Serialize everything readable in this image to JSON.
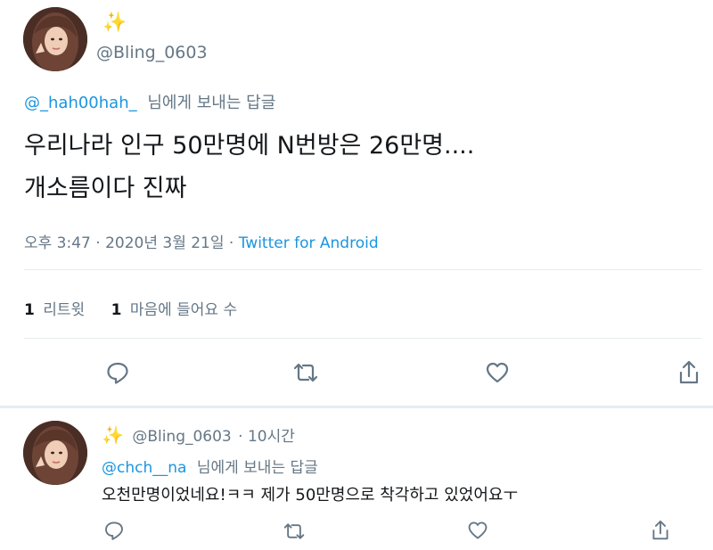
{
  "main_tweet": {
    "sparkle": "✨",
    "handle": "@Bling_0603",
    "reply_to_user": "@_hah00hah_",
    "reply_to_suffix": "님에게 보내는 답글",
    "text_line1": "우리나라 인구 50만명에 N번방은 26만명....",
    "text_line2": "개소름이다 진짜",
    "timestamp": "오후 3:47 · 2020년 3월 21일 · ",
    "source": "Twitter for Android",
    "retweet_count": "1",
    "retweet_label": "리트윗",
    "like_count": "1",
    "like_label": "마음에 들어요 수"
  },
  "reply_tweet": {
    "sparkle": "✨",
    "handle": "@Bling_0603",
    "time": "· 10시간",
    "reply_to_user": "@chch__na",
    "reply_to_suffix": "님에게 보내는 답글",
    "text": "오천만명이었네요!ㅋㅋ 제가 50만명으로 착각하고 있었어요ㅜ"
  },
  "icons": {
    "reply": "reply-icon",
    "retweet": "retweet-icon",
    "like": "heart-icon",
    "share": "share-icon"
  },
  "colors": {
    "link": "#1b95e0",
    "muted": "#657786",
    "text": "#14171a"
  }
}
